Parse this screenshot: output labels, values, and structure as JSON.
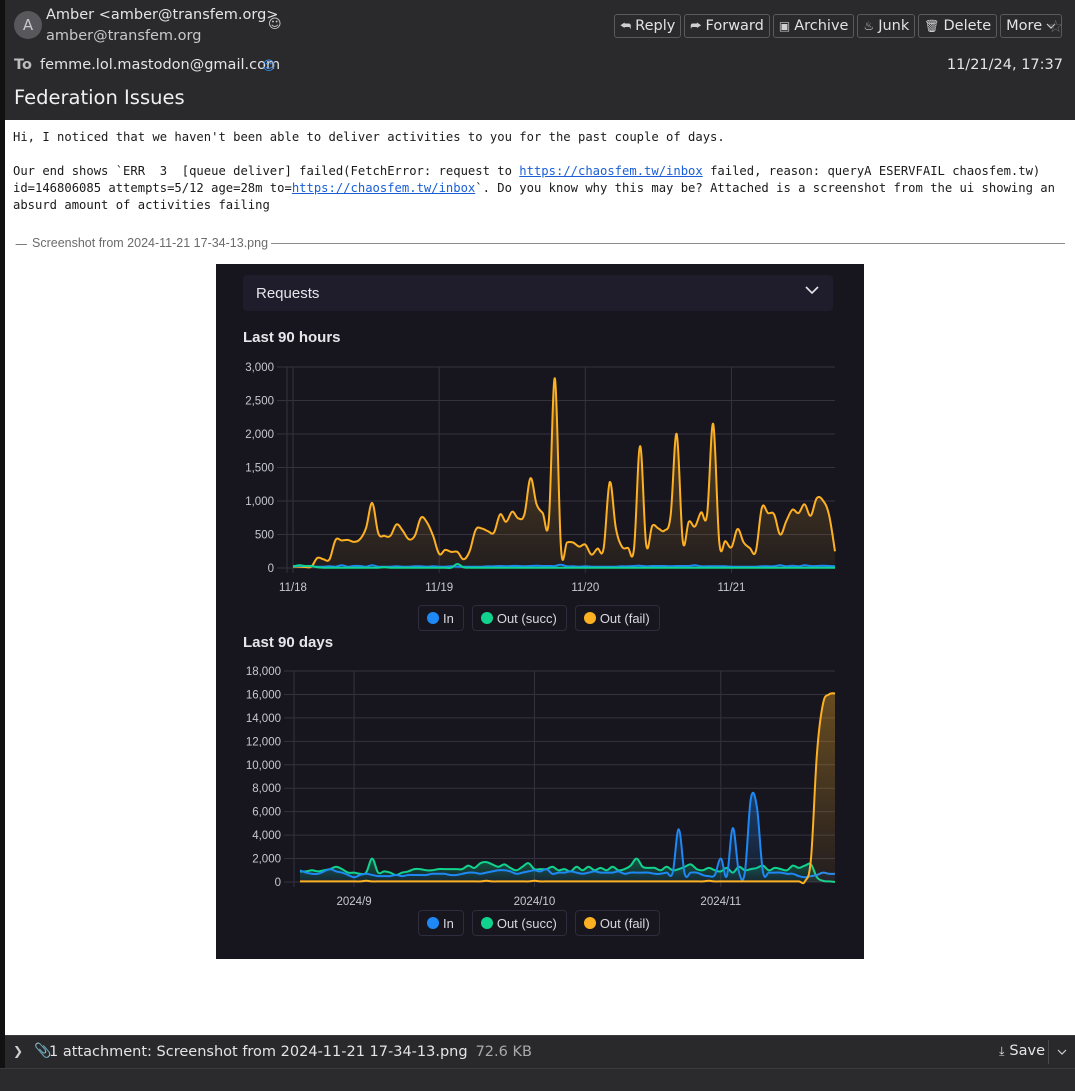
{
  "header": {
    "avatar_initial": "A",
    "from": "Amber <amber@transfem.org>",
    "from_address": "amber@transfem.org",
    "to_label": "To",
    "to": "femme.lol.mastodon@gmail.com",
    "date": "11/21/24, 17:37",
    "subject": "Federation Issues",
    "toolbar": [
      {
        "label": "Reply",
        "icon": "reply-icon",
        "glyph": "⮪"
      },
      {
        "label": "Forward",
        "icon": "forward-icon",
        "glyph": "⮫"
      },
      {
        "label": "Archive",
        "icon": "archive-icon",
        "glyph": "▣"
      },
      {
        "label": "Junk",
        "icon": "junk-icon",
        "glyph": "♨"
      },
      {
        "label": "Delete",
        "icon": "trash-icon",
        "glyph": "🗑"
      },
      {
        "label": "More",
        "icon": "chevron-down-icon",
        "glyph": "⌄"
      }
    ]
  },
  "body": {
    "line1": "Hi, I noticed that we haven't been able to deliver activities to you for the past couple of days.",
    "line2_pre": "Our end shows `ERR  3  [queue deliver] failed(FetchError: request to ",
    "line2_link": "https://chaosfem.tw/inbox",
    "line2_post": " failed, reason: queryA ESERVFAIL chaosfem.tw)",
    "line3_pre": "id=146806085 attempts=5/12 age=28m to=",
    "line3_link": "https://chaosfem.tw/inbox",
    "line3_post": "`. Do you know why this may be? Attached is a screenshot from the ui showing an",
    "line4": "absurd amount of activities failing",
    "attachment_title": "Screenshot from 2024-11-21 17-34-13.png"
  },
  "screenshot": {
    "section_title": "Requests",
    "legend": [
      {
        "label": "In",
        "color": "#1e88f5"
      },
      {
        "label": "Out (succ)",
        "color": "#10d48e"
      },
      {
        "label": "Out (fail)",
        "color": "#fdb022"
      }
    ]
  },
  "chart_data": [
    {
      "type": "line",
      "title": "Last 90 hours",
      "ylim": [
        0,
        3000
      ],
      "yticks": [
        "0",
        "500",
        "1,000",
        "1,500",
        "2,000",
        "2,500",
        "3,000"
      ],
      "xtick_labels": [
        "11/18",
        "11/19",
        "11/20",
        "11/21"
      ],
      "x_range_hours": [
        0,
        89
      ],
      "xtick_positions_hours": [
        0,
        24,
        48,
        72
      ],
      "grid": true,
      "series": [
        {
          "name": "Out (fail)",
          "color": "#fdb022",
          "fill": true,
          "values": [
            20,
            20,
            15,
            20,
            150,
            130,
            130,
            420,
            410,
            420,
            390,
            430,
            600,
            970,
            520,
            480,
            480,
            650,
            560,
            430,
            480,
            750,
            680,
            480,
            210,
            270,
            240,
            240,
            130,
            250,
            570,
            590,
            550,
            530,
            800,
            690,
            840,
            740,
            800,
            1340,
            950,
            820,
            700,
            2830,
            300,
            380,
            380,
            320,
            350,
            200,
            290,
            290,
            1280,
            600,
            320,
            300,
            290,
            1820,
            350,
            630,
            590,
            560,
            780,
            2000,
            400,
            690,
            620,
            830,
            800,
            2150,
            380,
            400,
            310,
            580,
            380,
            300,
            250,
            900,
            820,
            800,
            500,
            700,
            870,
            820,
            950,
            780,
            1040,
            1010,
            800,
            250
          ]
        },
        {
          "name": "In",
          "color": "#1e88f5",
          "fill": false,
          "values": [
            30,
            30,
            30,
            25,
            20,
            20,
            25,
            20,
            40,
            20,
            30,
            30,
            20,
            40,
            20,
            20,
            20,
            25,
            20,
            20,
            25,
            25,
            20,
            25,
            20,
            20,
            25,
            20,
            20,
            20,
            20,
            20,
            25,
            25,
            30,
            25,
            30,
            30,
            25,
            30,
            35,
            30,
            30,
            30,
            50,
            25,
            25,
            20,
            25,
            20,
            20,
            20,
            20,
            20,
            25,
            25,
            30,
            35,
            25,
            30,
            30,
            30,
            25,
            30,
            30,
            30,
            40,
            25,
            25,
            25,
            25,
            25,
            20,
            20,
            20,
            20,
            20,
            25,
            25,
            25,
            40,
            25,
            35,
            25,
            40,
            30,
            30,
            35,
            30,
            25
          ]
        },
        {
          "name": "Out (succ)",
          "color": "#10d48e",
          "fill": false,
          "values": [
            20,
            40,
            30,
            30,
            10,
            5,
            5,
            5,
            5,
            5,
            5,
            5,
            5,
            5,
            5,
            10,
            5,
            5,
            5,
            5,
            5,
            5,
            5,
            5,
            5,
            5,
            5,
            60,
            10,
            5,
            5,
            5,
            5,
            5,
            5,
            5,
            5,
            5,
            5,
            5,
            5,
            5,
            5,
            5,
            5,
            5,
            5,
            5,
            5,
            5,
            5,
            5,
            5,
            5,
            5,
            5,
            5,
            5,
            5,
            5,
            5,
            5,
            5,
            5,
            5,
            5,
            5,
            5,
            5,
            5,
            5,
            5,
            5,
            5,
            5,
            5,
            5,
            5,
            5,
            5,
            5,
            5,
            5,
            5,
            5,
            5,
            5,
            5,
            5,
            5
          ]
        }
      ]
    },
    {
      "type": "line",
      "title": "Last 90 days",
      "ylim": [
        0,
        18000
      ],
      "yticks": [
        "0",
        "2,000",
        "4,000",
        "6,000",
        "8,000",
        "10,000",
        "12,000",
        "14,000",
        "16,000",
        "18,000"
      ],
      "xtick_labels": [
        "2024/9",
        "2024/10",
        "2024/11"
      ],
      "x_range_days": [
        0,
        89
      ],
      "xtick_positions_days": [
        9,
        39,
        70
      ],
      "grid": true,
      "series": [
        {
          "name": "Out (succ)",
          "color": "#10d48e",
          "fill": true,
          "values": [
            900,
            900,
            1000,
            900,
            1000,
            1100,
            1300,
            1100,
            800,
            800,
            700,
            800,
            2000,
            800,
            900,
            800,
            600,
            800,
            900,
            1100,
            1100,
            1000,
            1000,
            1100,
            1100,
            1100,
            1100,
            1100,
            1400,
            1200,
            1600,
            1700,
            1500,
            1300,
            1500,
            1200,
            1000,
            1300,
            1600,
            1100,
            1100,
            1100,
            1300,
            1000,
            1100,
            900,
            1300,
            1000,
            1300,
            1000,
            1200,
            1000,
            1300,
            1000,
            1100,
            1400,
            2000,
            1300,
            1200,
            1200,
            1000,
            1300,
            1000,
            1100,
            1300,
            1500,
            1100,
            1000,
            1200,
            1000,
            900,
            1200,
            800,
            1300,
            1000,
            1100,
            1200,
            1400,
            1000,
            1200,
            1100,
            1000,
            1400,
            1200,
            1400,
            1500,
            400,
            100,
            50,
            0
          ]
        },
        {
          "name": "In",
          "color": "#1e88f5",
          "fill": true,
          "values": [
            1000,
            800,
            700,
            700,
            900,
            1100,
            900,
            800,
            600,
            400,
            600,
            700,
            600,
            500,
            500,
            500,
            600,
            500,
            600,
            600,
            600,
            600,
            700,
            700,
            700,
            600,
            600,
            700,
            800,
            800,
            700,
            800,
            900,
            1000,
            1000,
            900,
            700,
            800,
            900,
            1000,
            900,
            1100,
            700,
            800,
            800,
            900,
            800,
            700,
            800,
            900,
            800,
            800,
            800,
            900,
            700,
            800,
            800,
            800,
            800,
            700,
            700,
            800,
            800,
            4500,
            700,
            800,
            800,
            600,
            500,
            600,
            2000,
            500,
            4600,
            900,
            800,
            7100,
            6400,
            900,
            800,
            800,
            800,
            700,
            700,
            500,
            400,
            500,
            600,
            800,
            700,
            700
          ]
        },
        {
          "name": "Out (fail)",
          "color": "#fdb022",
          "fill": true,
          "values": [
            50,
            50,
            50,
            50,
            50,
            50,
            50,
            50,
            50,
            50,
            50,
            100,
            50,
            50,
            50,
            50,
            50,
            50,
            50,
            50,
            50,
            50,
            50,
            50,
            50,
            50,
            50,
            50,
            50,
            50,
            50,
            100,
            50,
            50,
            50,
            50,
            50,
            50,
            50,
            100,
            50,
            50,
            50,
            50,
            50,
            50,
            50,
            50,
            50,
            50,
            50,
            50,
            50,
            50,
            50,
            50,
            50,
            50,
            50,
            50,
            50,
            50,
            50,
            50,
            50,
            50,
            50,
            50,
            100,
            50,
            50,
            50,
            50,
            50,
            50,
            50,
            50,
            50,
            50,
            50,
            50,
            50,
            50,
            50,
            50,
            2000,
            11000,
            15200,
            16000,
            16100
          ]
        }
      ]
    }
  ],
  "footer": {
    "attachment_summary": "1 attachment: Screenshot from 2024-11-21 17-34-13.png",
    "attachment_size": "72.6 KB",
    "save_label": "Save"
  }
}
